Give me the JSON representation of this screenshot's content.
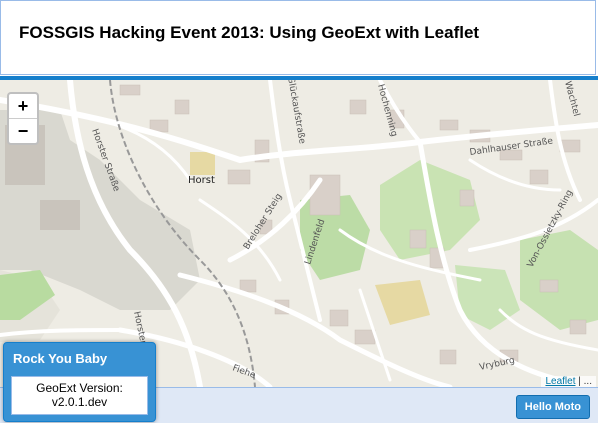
{
  "header": {
    "title": "FOSSGIS Hacking Event 2013: Using GeoExt with Leaflet"
  },
  "map": {
    "zoom_in": "+",
    "zoom_out": "−",
    "attribution_link": "Leaflet",
    "attribution_sep": " | ...",
    "place_labels": {
      "horst": "Horst",
      "horster_strasse_north": "Horster Straße",
      "horster_strasse_south": "Horster Straße",
      "dahlhauser": "Dahlhauser Straße",
      "breloher": "Breloher Steig",
      "lindenfeld": "Lindenfeld",
      "ossietzky": "Von-Ossietzky-Ring",
      "vryburg": "Vryburg",
      "glueck": "Glückaufstraße",
      "hoeren": "Hochenning",
      "wachtel": "Wachtel",
      "fiehe": "Fiehe"
    }
  },
  "window": {
    "title": "Rock You Baby",
    "line1": "GeoExt Version:",
    "line2": "v2.0.1.dev"
  },
  "footer": {
    "button_label": "Hello Moto"
  }
}
